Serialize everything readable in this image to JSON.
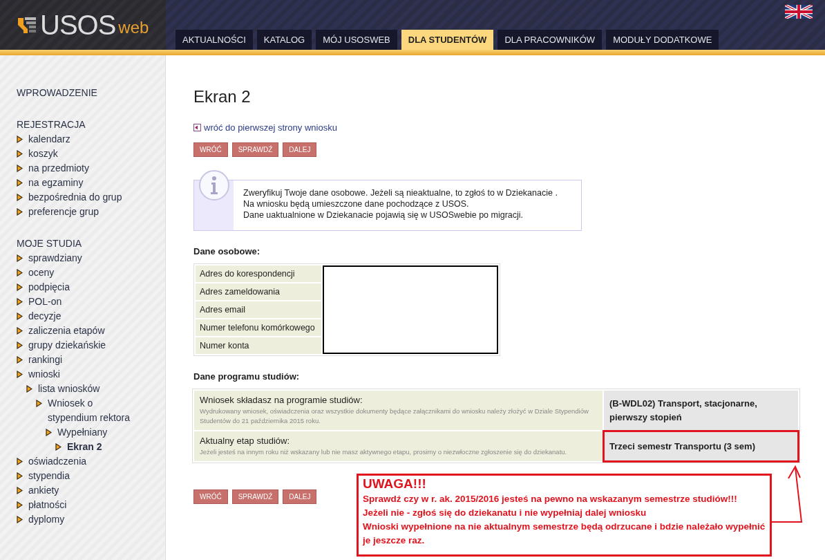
{
  "logo": {
    "name": "USOS",
    "suffix": "web"
  },
  "tabs": [
    {
      "label": "AKTUALNOŚCI",
      "selected": false
    },
    {
      "label": "KATALOG",
      "selected": false
    },
    {
      "label": "MÓJ USOSWEB",
      "selected": false
    },
    {
      "label": "DLA STUDENTÓW",
      "selected": true
    },
    {
      "label": "DLA PRACOWNIKÓW",
      "selected": false
    },
    {
      "label": "MODUŁY DODATKOWE",
      "selected": false
    }
  ],
  "sidebar": {
    "sections": [
      {
        "title": "WPROWADZENIE"
      },
      {
        "title": "REJESTRACJA",
        "items": [
          {
            "label": "kalendarz",
            "selected": false
          },
          {
            "label": "koszyk",
            "selected": false
          },
          {
            "label": "na przedmioty",
            "selected": false
          },
          {
            "label": "na egzaminy",
            "selected": false
          },
          {
            "label": "bezpośrednia do grup",
            "selected": false
          },
          {
            "label": "preferencje grup",
            "selected": false
          }
        ]
      },
      {
        "title": "MOJE STUDIA",
        "items": [
          {
            "label": "sprawdziany",
            "selected": false
          },
          {
            "label": "oceny",
            "selected": false
          },
          {
            "label": "podpięcia",
            "selected": false
          },
          {
            "label": "POL-on",
            "selected": false
          },
          {
            "label": "decyzje",
            "selected": false
          },
          {
            "label": "zaliczenia etapów",
            "selected": false
          },
          {
            "label": "grupy dziekańskie",
            "selected": false
          },
          {
            "label": "rankingi",
            "selected": false
          },
          {
            "label": "wnioski",
            "selected": false,
            "children": [
              {
                "label": "lista wniosków",
                "selected": false,
                "children": [
                  {
                    "label": "Wniosek o stypendium rektora",
                    "selected": false,
                    "children": [
                      {
                        "label": "Wypełniany",
                        "selected": false,
                        "children": [
                          {
                            "label": "Ekran 2",
                            "selected": true
                          }
                        ]
                      }
                    ]
                  }
                ]
              }
            ]
          },
          {
            "label": "oświadczenia",
            "selected": false
          },
          {
            "label": "stypendia",
            "selected": false
          },
          {
            "label": "ankiety",
            "selected": false
          },
          {
            "label": "płatności",
            "selected": false
          },
          {
            "label": "dyplomy",
            "selected": false
          }
        ]
      }
    ]
  },
  "page": {
    "title": "Ekran 2",
    "back_link": "wróć do pierwszej strony wniosku",
    "buttons_top": [
      "WRÓĆ",
      "SPRAWDŹ",
      "DALEJ"
    ],
    "info": [
      "Zweryfikuj Twoje dane osobowe. Jeżeli są nieaktualne, to zgłoś to w Dziekanacie .",
      "Na wniosku będą umieszczone dane pochodzące z USOS.",
      "Dane uaktualnione w Dziekanacie pojawią się w USOSwebie po migracji."
    ],
    "personal": {
      "heading": "Dane osobowe:",
      "rows": [
        "Adres do korespondencji",
        "Adres zameldowania",
        "Adres email",
        "Numer telefonu komórkowego",
        "Numer konta"
      ]
    },
    "program": {
      "heading": "Dane programu studiów:",
      "rows": [
        {
          "label": "Wniosek składasz na programie studiów:",
          "note": "Wydrukowany wniosek, oświadczenia oraz wszystkie dokumenty będące załącznikami do wniosku należy złożyć w Dziale Stypendiów Studentów do 21 października 2015 roku.",
          "value": "(B-WDL02) Transport, stacjonarne, pierwszy stopień",
          "highlighted": false
        },
        {
          "label": "Aktualny etap studiów:",
          "note": "Jeżeli jesteś na innym roku niż wskazany lub nie masz aktywnego etapu, prosimy o niezwłoczne zgłoszenie się do dziekanatu.",
          "value": "Trzeci semestr Transportu (3 sem)",
          "highlighted": true
        }
      ]
    },
    "buttons_bottom": [
      "WRÓĆ",
      "SPRAWDŹ",
      "DALEJ"
    ]
  },
  "annotation": {
    "title": "UWAGA!!!",
    "lines": [
      "Sprawdź czy w r. ak. 2015/2016 jesteś na pewno na wskazanym semestrze studiów!!!",
      "Jeżeli nie - zgłoś się do dziekanatu i nie wypełniaj dalej wniosku",
      "Wnioski wypełnione na nie aktualnym semestrze będą odrzucane i bdzie należało wypełnić je jeszcze raz."
    ]
  }
}
